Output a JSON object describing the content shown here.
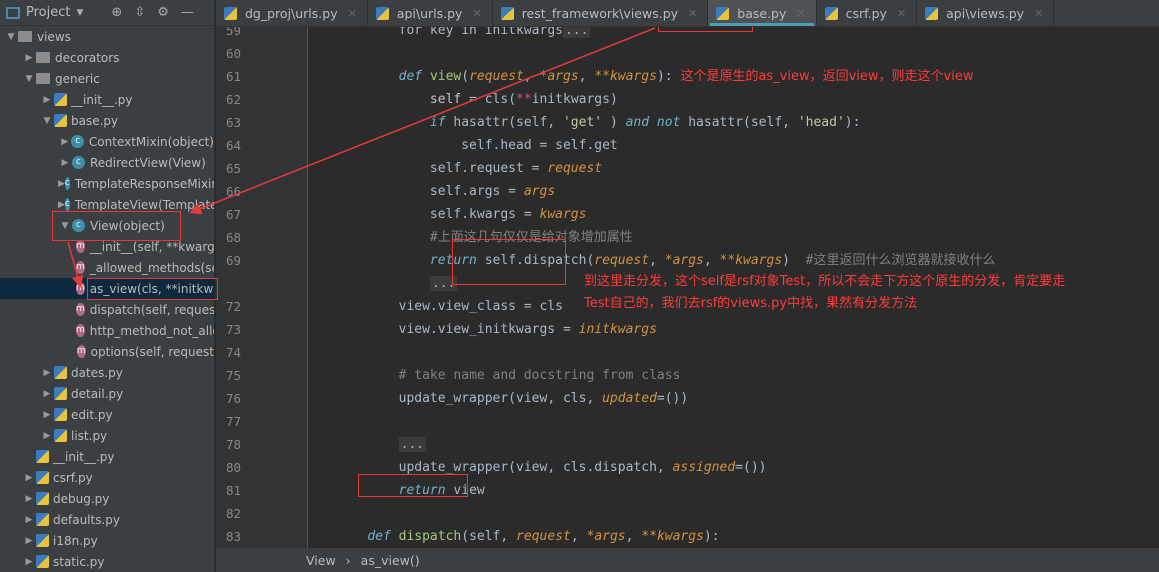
{
  "sidebar": {
    "title": "Project",
    "tree": [
      {
        "label": "views",
        "depth": 0,
        "exp": "open",
        "icon": "folder"
      },
      {
        "label": "decorators",
        "depth": 1,
        "exp": "closed",
        "icon": "folder"
      },
      {
        "label": "generic",
        "depth": 1,
        "exp": "open",
        "icon": "folder"
      },
      {
        "label": "__init__.py",
        "depth": 2,
        "exp": "closed",
        "icon": "py"
      },
      {
        "label": "base.py",
        "depth": 2,
        "exp": "open",
        "icon": "py"
      },
      {
        "label": "ContextMixin(object)",
        "depth": 3,
        "exp": "closed",
        "icon": "class"
      },
      {
        "label": "RedirectView(View)",
        "depth": 3,
        "exp": "closed",
        "icon": "class"
      },
      {
        "label": "TemplateResponseMixin",
        "depth": 3,
        "exp": "closed",
        "icon": "class"
      },
      {
        "label": "TemplateView(TemplateResponseMixin",
        "depth": 3,
        "exp": "closed",
        "icon": "class"
      },
      {
        "label": "View(object)",
        "depth": 3,
        "exp": "open",
        "icon": "class"
      },
      {
        "label": "__init__(self, **kwargs)",
        "depth": 4,
        "exp": "",
        "icon": "method"
      },
      {
        "label": "_allowed_methods(self)",
        "depth": 4,
        "exp": "",
        "icon": "method"
      },
      {
        "label": "as_view(cls, **initkwargs)",
        "depth": 4,
        "exp": "",
        "icon": "method",
        "selected": true
      },
      {
        "label": "dispatch(self, request",
        "depth": 4,
        "exp": "",
        "icon": "method"
      },
      {
        "label": "http_method_not_allowed",
        "depth": 4,
        "exp": "",
        "icon": "method"
      },
      {
        "label": "options(self, request",
        "depth": 4,
        "exp": "",
        "icon": "method"
      },
      {
        "label": "dates.py",
        "depth": 2,
        "exp": "closed",
        "icon": "py"
      },
      {
        "label": "detail.py",
        "depth": 2,
        "exp": "closed",
        "icon": "py"
      },
      {
        "label": "edit.py",
        "depth": 2,
        "exp": "closed",
        "icon": "py"
      },
      {
        "label": "list.py",
        "depth": 2,
        "exp": "closed",
        "icon": "py"
      },
      {
        "label": "__init__.py",
        "depth": 1,
        "exp": "",
        "icon": "py"
      },
      {
        "label": "csrf.py",
        "depth": 1,
        "exp": "closed",
        "icon": "py"
      },
      {
        "label": "debug.py",
        "depth": 1,
        "exp": "closed",
        "icon": "py"
      },
      {
        "label": "defaults.py",
        "depth": 1,
        "exp": "closed",
        "icon": "py"
      },
      {
        "label": "i18n.py",
        "depth": 1,
        "exp": "closed",
        "icon": "py"
      },
      {
        "label": "static.py",
        "depth": 1,
        "exp": "closed",
        "icon": "py"
      }
    ]
  },
  "tabs": [
    {
      "label": "dg_proj\\urls.py"
    },
    {
      "label": "api\\urls.py"
    },
    {
      "label": "rest_framework\\views.py"
    },
    {
      "label": "base.py",
      "active": true
    },
    {
      "label": "csrf.py"
    },
    {
      "label": "api\\views.py"
    }
  ],
  "code": [
    {
      "n": "59",
      "t": [
        [
          "",
          "        for key in initkwargs"
        ],
        [
          "fd",
          "..."
        ]
      ]
    },
    {
      "n": "60",
      "t": []
    },
    {
      "n": "61",
      "t": [
        [
          "",
          "        "
        ],
        [
          "kw",
          "def"
        ],
        [
          "",
          " "
        ],
        [
          "fn",
          "view"
        ],
        [
          "",
          "("
        ],
        [
          "pa",
          "request"
        ],
        [
          "",
          ", "
        ],
        [
          "pa",
          "*args"
        ],
        [
          "",
          ", "
        ],
        [
          "pa",
          "**kwargs"
        ],
        [
          "",
          "): "
        ],
        [
          "ann",
          "这个是原生的as_view，返回view，则走这个view"
        ]
      ]
    },
    {
      "n": "62",
      "t": [
        [
          "",
          "            "
        ],
        [
          "sf",
          "self"
        ],
        [
          "",
          " = cls("
        ],
        [
          "op",
          "**"
        ],
        [
          "",
          "initkwargs)"
        ]
      ]
    },
    {
      "n": "63",
      "t": [
        [
          "",
          "            "
        ],
        [
          "kw",
          "if"
        ],
        [
          "",
          " hasattr(self, "
        ],
        [
          "st",
          "'get'"
        ],
        [
          "",
          " ) "
        ],
        [
          "kw",
          "and not"
        ],
        [
          "",
          " hasattr(self, "
        ],
        [
          "st",
          "'head'"
        ],
        [
          "",
          "):"
        ]
      ]
    },
    {
      "n": "64",
      "t": [
        [
          "",
          "                self.head = self.get"
        ]
      ]
    },
    {
      "n": "65",
      "t": [
        [
          "",
          "            self.request = "
        ],
        [
          "pa",
          "request"
        ]
      ]
    },
    {
      "n": "66",
      "t": [
        [
          "",
          "            self.args = "
        ],
        [
          "pa",
          "args"
        ]
      ]
    },
    {
      "n": "67",
      "t": [
        [
          "",
          "            self.kwargs = "
        ],
        [
          "pa",
          "kwargs"
        ]
      ]
    },
    {
      "n": "68",
      "t": [
        [
          "",
          "            "
        ],
        [
          "cm",
          "#上面这几句仅仅是给对象增加属性"
        ]
      ]
    },
    {
      "n": "69",
      "t": [
        [
          "",
          "            "
        ],
        [
          "kw",
          "return"
        ],
        [
          "",
          " self.dispatch("
        ],
        [
          "pa",
          "request"
        ],
        [
          "",
          ", "
        ],
        [
          "pa",
          "*args"
        ],
        [
          "",
          ", "
        ],
        [
          "pa",
          "**kwargs"
        ],
        [
          "",
          ")  "
        ],
        [
          "cm",
          "#这里返回什么浏览器就接收什么"
        ]
      ]
    },
    {
      "n": "",
      "t": [
        [
          "",
          "            "
        ],
        [
          "fd",
          "..."
        ]
      ]
    },
    {
      "n": "72",
      "t": [
        [
          "",
          "        view.view_class = cls"
        ]
      ]
    },
    {
      "n": "73",
      "t": [
        [
          "",
          "        view.view_initkwargs = "
        ],
        [
          "pa",
          "initkwargs"
        ]
      ]
    },
    {
      "n": "74",
      "t": []
    },
    {
      "n": "75",
      "t": [
        [
          "",
          "        "
        ],
        [
          "cm",
          "# take name and docstring from class"
        ]
      ]
    },
    {
      "n": "76",
      "t": [
        [
          "",
          "        update_wrapper(view, cls, "
        ],
        [
          "pa",
          "updated"
        ],
        [
          "",
          "=())"
        ]
      ]
    },
    {
      "n": "77",
      "t": []
    },
    {
      "n": "78",
      "t": [
        [
          "",
          "        "
        ],
        [
          "fd",
          "..."
        ]
      ]
    },
    {
      "n": "80",
      "t": [
        [
          "",
          "        update_wrapper(view, cls.dispatch, "
        ],
        [
          "pa",
          "assigned"
        ],
        [
          "",
          "=())"
        ]
      ]
    },
    {
      "n": "81",
      "t": [
        [
          "",
          "        "
        ],
        [
          "kw",
          "return"
        ],
        [
          "",
          " view"
        ]
      ]
    },
    {
      "n": "82",
      "t": []
    },
    {
      "n": "83",
      "t": [
        [
          "",
          "    "
        ],
        [
          "kw",
          "def"
        ],
        [
          "",
          " "
        ],
        [
          "fn",
          "dispatch"
        ],
        [
          "",
          "(self, "
        ],
        [
          "pa",
          "request"
        ],
        [
          "",
          ", "
        ],
        [
          "pa",
          "*args"
        ],
        [
          "",
          ", "
        ],
        [
          "pa",
          "**kwargs"
        ],
        [
          "",
          "):"
        ]
      ]
    }
  ],
  "annotation": {
    "line1": "到这里走分发，这个self是rsf对象Test，所以不会走下方这个原生的分发，肯定要走",
    "line2": "Test自己的，我们去rsf的views.py中找，果然有分发方法"
  },
  "breadcrumb": [
    "View",
    "as_view()"
  ],
  "colors": {
    "annotation": "#ff3b3b",
    "highlight_box": "#e53a3a",
    "editor_bg": "#2b2b2b",
    "sidebar_bg": "#3c3f41"
  }
}
